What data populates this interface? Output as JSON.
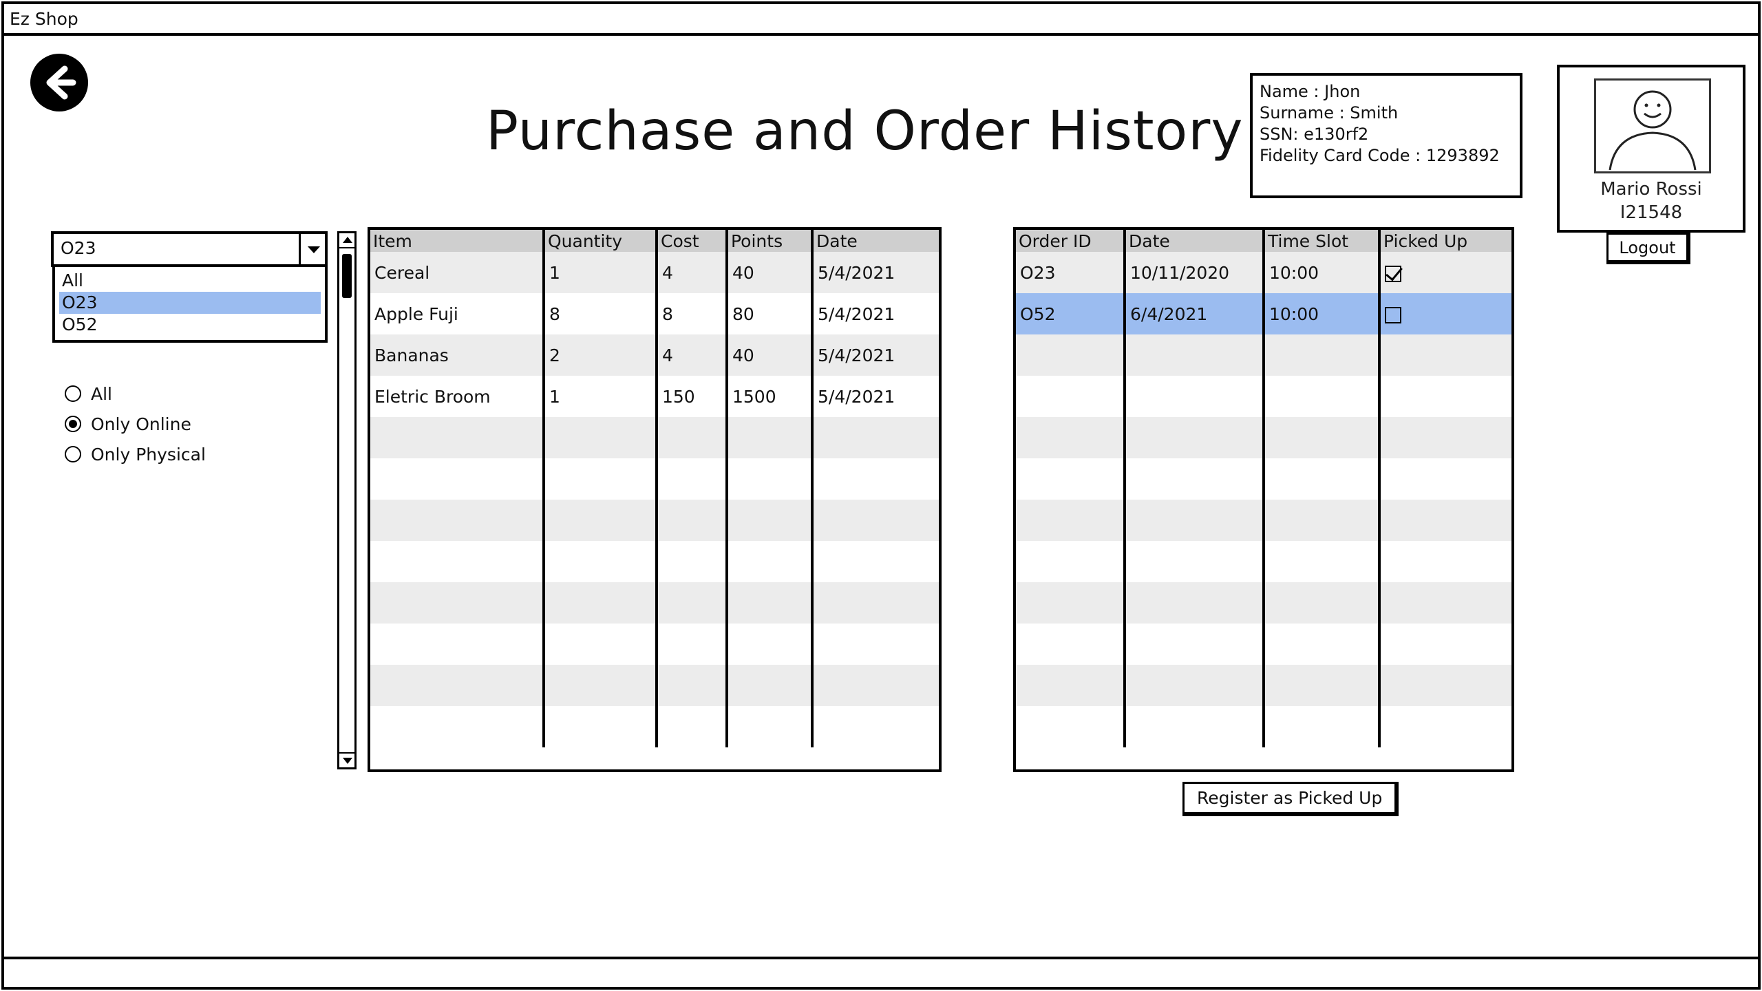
{
  "window": {
    "title": "Ez Shop"
  },
  "page": {
    "title": "Purchase and Order History"
  },
  "user_info": {
    "name": "Name : Jhon",
    "surname": "Surname : Smith",
    "ssn": "SSN: e130rf2",
    "fidelity": "Fidelity Card Code : 1293892"
  },
  "profile": {
    "name": "Mario Rossi",
    "id": "I21548",
    "logout_label": "Logout"
  },
  "order_filter": {
    "value": "O23",
    "options": [
      "All",
      "O23",
      "O52"
    ],
    "selected_index": 1
  },
  "radio_filter": {
    "options": [
      "All",
      "Only Online",
      "Only Physical"
    ],
    "selected_index": 1
  },
  "purchases": {
    "headers": [
      "Item",
      "Quantity",
      "Cost",
      "Points",
      "Date"
    ],
    "rows": [
      [
        "Cereal",
        "1",
        "4",
        "40",
        "5/4/2021"
      ],
      [
        "Apple Fuji",
        "8",
        "8",
        "80",
        "5/4/2021"
      ],
      [
        "Bananas",
        "2",
        "4",
        "40",
        "5/4/2021"
      ],
      [
        "Eletric Broom",
        "1",
        "150",
        "1500",
        "5/4/2021"
      ]
    ]
  },
  "orders": {
    "headers": [
      "Order ID",
      "Date",
      "Time Slot",
      "Picked Up"
    ],
    "rows": [
      {
        "id": "O23",
        "date": "10/11/2020",
        "slot": "10:00",
        "picked_up": true,
        "selected": false
      },
      {
        "id": "O52",
        "date": "6/4/2021",
        "slot": "10:00",
        "picked_up": false,
        "selected": true
      }
    ]
  },
  "actions": {
    "register_label": "Register as Picked Up"
  },
  "colors": {
    "selection": "#9bbcf0",
    "stripe": "#ececec",
    "header": "#cfcfcf"
  }
}
